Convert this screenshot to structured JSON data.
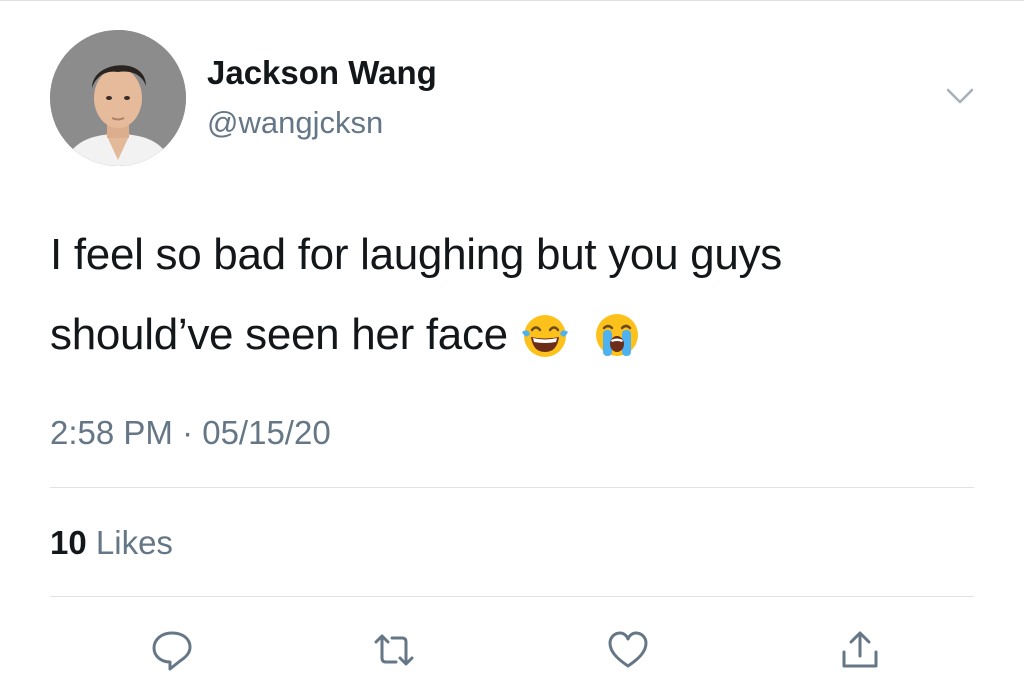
{
  "tweet": {
    "author": {
      "display_name": "Jackson Wang",
      "handle": "@wangjcksn"
    },
    "text_line1": "I feel so bad for laughing but you guys",
    "text_line2": "should’ve seen her face",
    "emojis": [
      "face-with-tears-of-joy",
      "loudly-crying-face"
    ],
    "timestamp": "2:58 PM · 05/15/20",
    "likes_count": "10",
    "likes_label": "Likes"
  },
  "actions": [
    "reply-icon",
    "retweet-icon",
    "like-icon",
    "share-icon"
  ],
  "colors": {
    "text": "#14171a",
    "secondary": "#657786",
    "divider": "#dfe3e8"
  }
}
